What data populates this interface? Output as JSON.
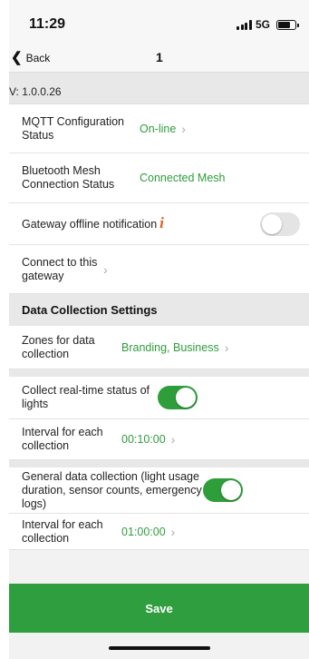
{
  "status_bar": {
    "time": "11:29",
    "network": "5G"
  },
  "nav": {
    "back_label": "Back",
    "title": "1"
  },
  "version": "V: 1.0.0.26",
  "rows": {
    "mqtt": {
      "label": "MQTT Configuration Status",
      "value": "On-line"
    },
    "mesh": {
      "label": "Bluetooth Mesh Connection Status",
      "value": "Connected Mesh"
    },
    "offline": {
      "label": "Gateway offline notification",
      "icon": "i",
      "toggle": "off"
    },
    "connect": {
      "label": "Connect to this gateway"
    }
  },
  "section": {
    "title": "Data Collection Settings"
  },
  "collection": {
    "zones": {
      "label": "Zones for data collection",
      "value": "Branding, Business"
    },
    "realtime": {
      "label": "Collect real-time status of lights",
      "toggle": "on"
    },
    "interval1": {
      "label": "Interval for each collection",
      "value": "00:10:00"
    },
    "general": {
      "label": "General data collection (light usage duration, sensor counts, emergency logs)",
      "toggle": "on"
    },
    "interval2": {
      "label": "Interval for each collection",
      "value": "01:00:00"
    }
  },
  "save_label": "Save",
  "colors": {
    "accent": "#2e9e3a",
    "warning": "#e05a1f"
  }
}
